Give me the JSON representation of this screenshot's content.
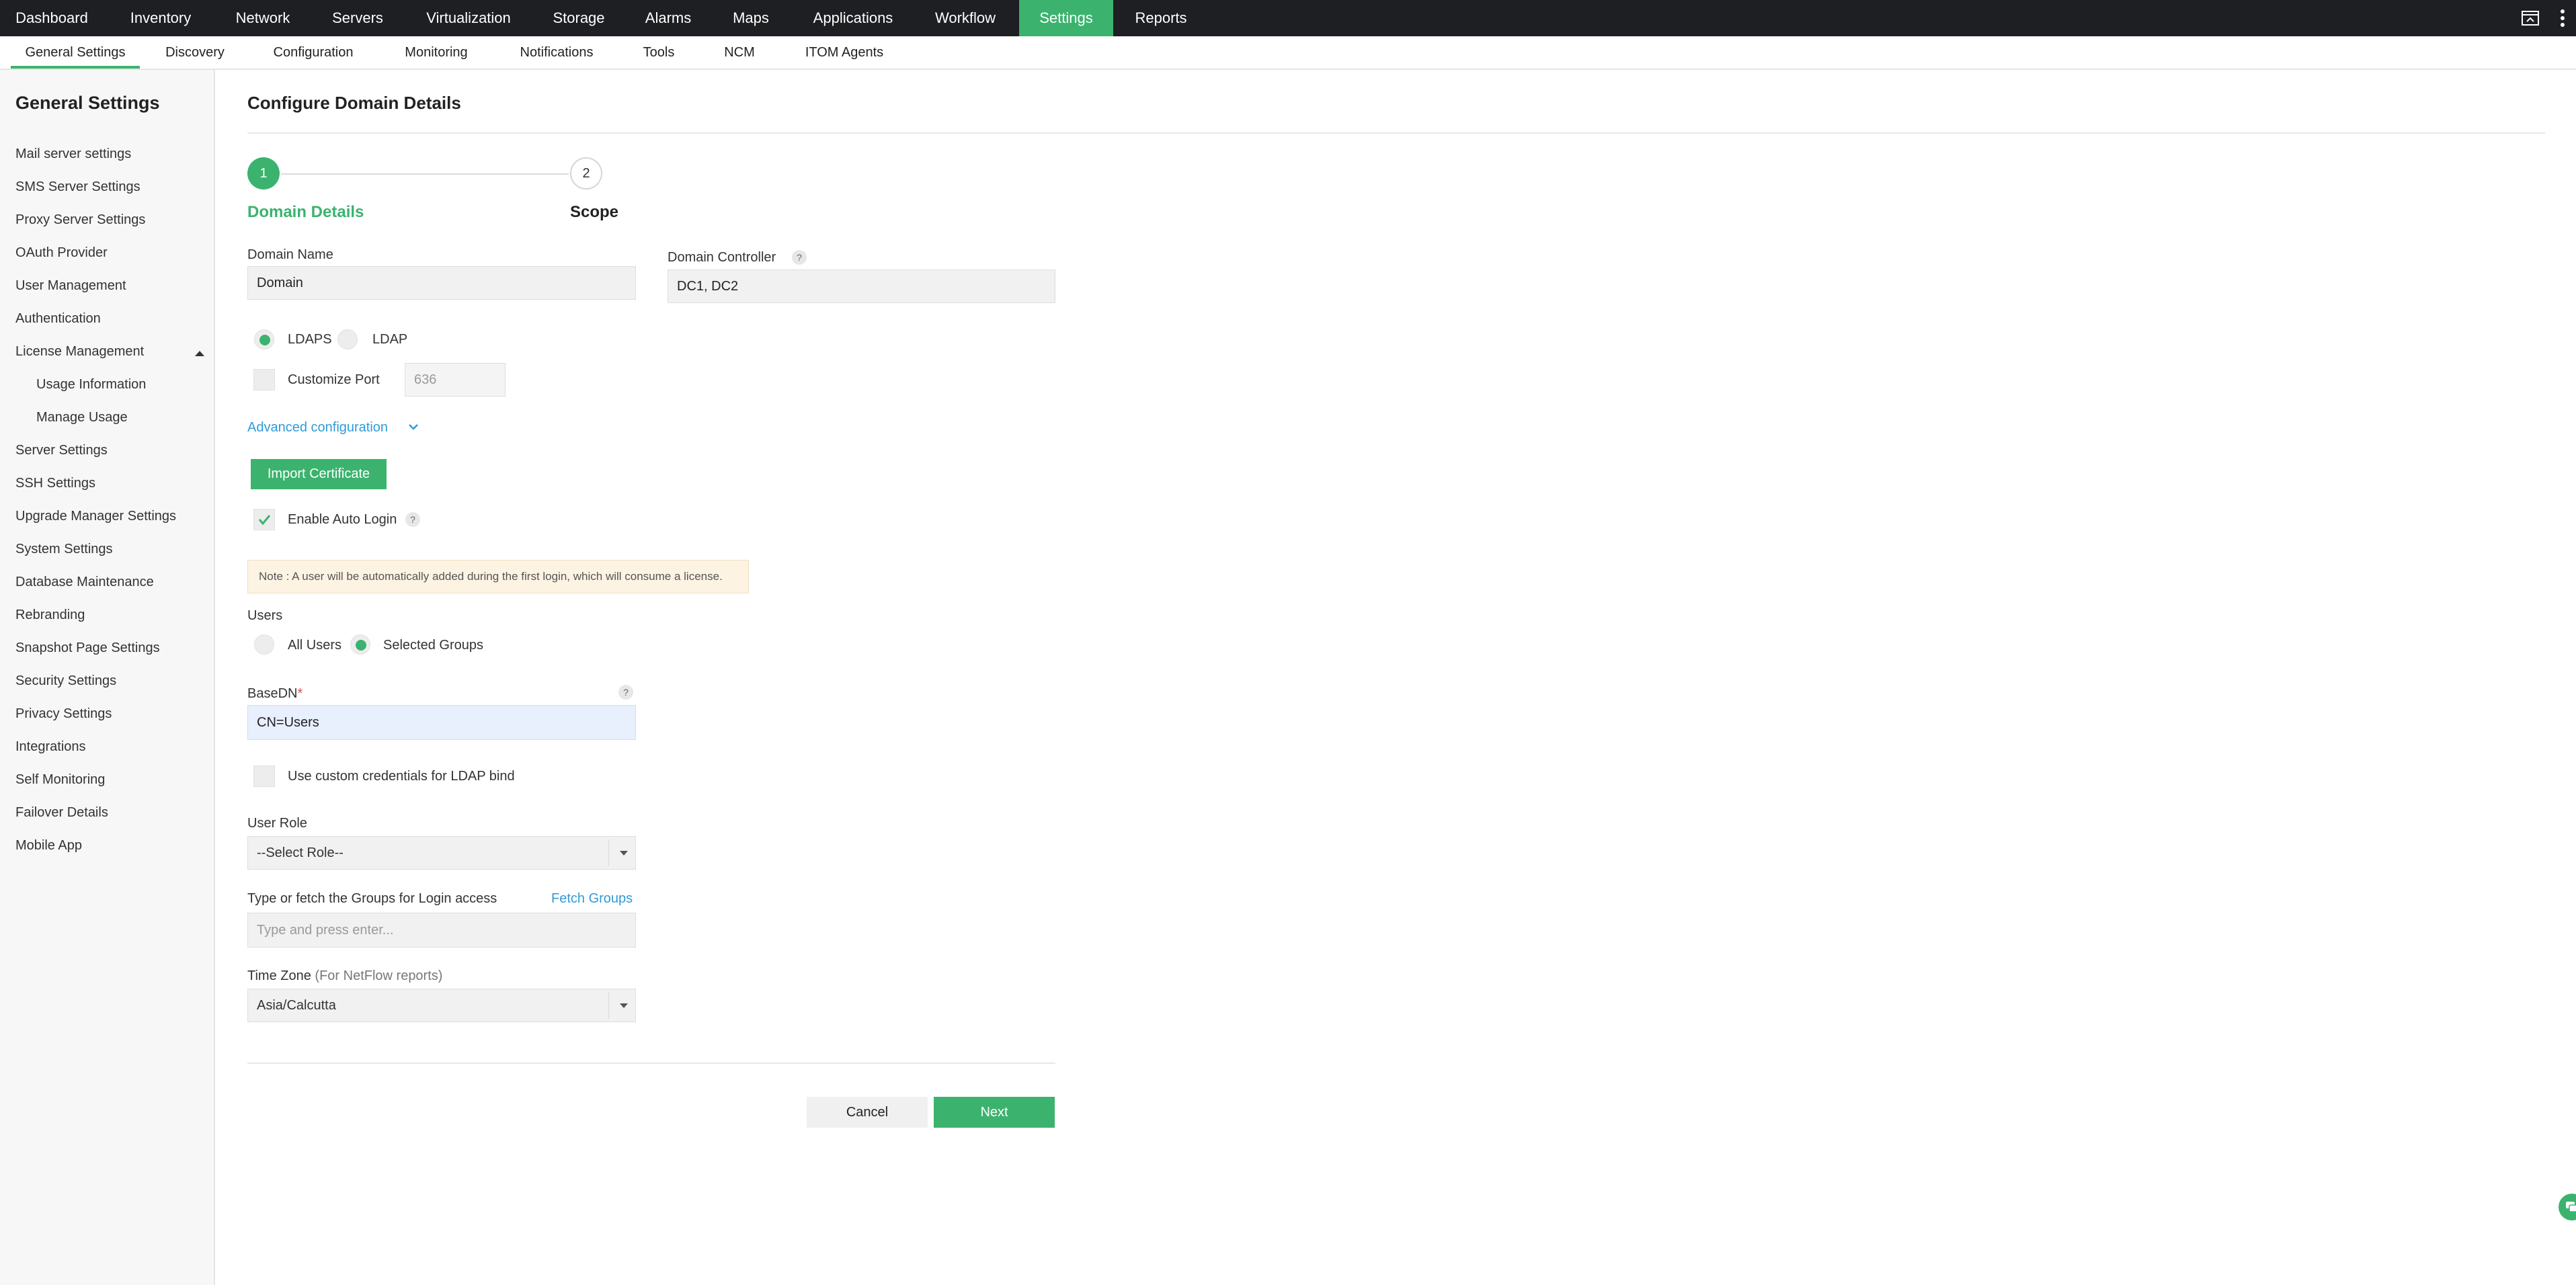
{
  "topnav": {
    "items": [
      "Dashboard",
      "Inventory",
      "Network",
      "Servers",
      "Virtualization",
      "Storage",
      "Alarms",
      "Maps",
      "Applications",
      "Workflow",
      "Settings",
      "Reports"
    ],
    "active": "Settings",
    "icons": [
      "screen-icon",
      "more-vertical-icon"
    ]
  },
  "subnav": {
    "items": [
      "General Settings",
      "Discovery",
      "Configuration",
      "Monitoring",
      "Notifications",
      "Tools",
      "NCM",
      "ITOM Agents"
    ],
    "active": "General Settings"
  },
  "sidebar": {
    "title": "General Settings",
    "items": [
      {
        "label": "Mail server settings",
        "level": 0
      },
      {
        "label": "SMS Server Settings",
        "level": 0
      },
      {
        "label": "Proxy Server Settings",
        "level": 0
      },
      {
        "label": "OAuth Provider",
        "level": 0
      },
      {
        "label": "User Management",
        "level": 0
      },
      {
        "label": "Authentication",
        "level": 0
      },
      {
        "label": "License Management",
        "level": 0,
        "expanded": true
      },
      {
        "label": "Usage Information",
        "level": 1
      },
      {
        "label": "Manage Usage",
        "level": 1
      },
      {
        "label": "Server Settings",
        "level": 0
      },
      {
        "label": "SSH Settings",
        "level": 0
      },
      {
        "label": "Upgrade Manager Settings",
        "level": 0
      },
      {
        "label": "System Settings",
        "level": 0
      },
      {
        "label": "Database Maintenance",
        "level": 0
      },
      {
        "label": "Rebranding",
        "level": 0
      },
      {
        "label": "Snapshot Page Settings",
        "level": 0
      },
      {
        "label": "Security Settings",
        "level": 0
      },
      {
        "label": "Privacy Settings",
        "level": 0
      },
      {
        "label": "Integrations",
        "level": 0
      },
      {
        "label": "Self Monitoring",
        "level": 0
      },
      {
        "label": "Failover Details",
        "level": 0
      },
      {
        "label": "Mobile App",
        "level": 0
      }
    ]
  },
  "main": {
    "title": "Configure Domain Details",
    "steps": [
      {
        "number": "1",
        "label": "Domain Details",
        "state": "current"
      },
      {
        "number": "2",
        "label": "Scope",
        "state": "pending"
      }
    ],
    "domain_name": {
      "label": "Domain Name",
      "value": "Domain"
    },
    "domain_controller": {
      "label": "Domain Controller",
      "value": "DC1, DC2",
      "help": "?"
    },
    "protocol": {
      "options": [
        "LDAPS",
        "LDAP"
      ],
      "selected": "LDAPS"
    },
    "customize_port": {
      "label": "Customize Port",
      "checked": false,
      "placeholder": "636"
    },
    "advanced_link": "Advanced configuration",
    "import_certificate": "Import Certificate",
    "auto_login": {
      "label": "Enable Auto Login",
      "checked": true,
      "help": "?"
    },
    "note": "Note : A user will be automatically added during the first login, which will consume a license.",
    "users": {
      "label": "Users",
      "options": [
        "All Users",
        "Selected Groups"
      ],
      "selected": "Selected Groups"
    },
    "basedn": {
      "label": "BaseDN",
      "required_mark": "*",
      "value": "CN=Users",
      "help": "?"
    },
    "custom_credentials": {
      "label": "Use custom credentials for LDAP bind",
      "checked": false
    },
    "user_role": {
      "label": "User Role",
      "value": "--Select Role--"
    },
    "groups": {
      "label": "Type or fetch the Groups for Login access",
      "fetch_link": "Fetch Groups",
      "placeholder": "Type and press enter..."
    },
    "timezone": {
      "label": "Time Zone",
      "hint": "(For NetFlow reports)",
      "value": "Asia/Calcutta"
    },
    "buttons": {
      "cancel": "Cancel",
      "next": "Next"
    }
  },
  "colors": {
    "accent": "#3bb36e",
    "link": "#2f9bd8",
    "nav_bg": "#1d1f22",
    "note_bg": "#fdf3e3"
  }
}
